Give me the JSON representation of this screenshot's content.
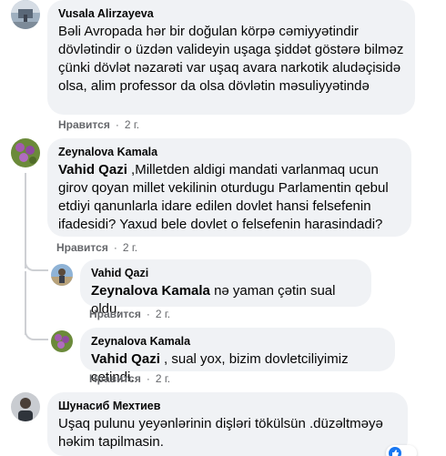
{
  "comments": [
    {
      "author": "Vusala Alirzayeva",
      "text": "Bəli Avropada hər bir doğulan körpə cəmiyyətindir dövlətindir o üzdən valideyin uşaga şiddət göstərə bilməz çünki dövlət nəzarəti var uşaq avara narkotik aludəçisidə olsa, alim professor da olsa dövlətin məsuliyyətində",
      "like_label": "Нравится",
      "time": "2 г."
    },
    {
      "author": "Zeynalova Kamala",
      "mention": "Vahid Qazi",
      "text": " ,Milletden aldigi mandati varlanmaq ucun girov qoyan millet vekilinin oturdugu Parlamentin qebul etdiyi qanunlarla idare edilen dovlet hansi felsefenin ifadesidi? Yaxud bele dovlet o felsefenin harasindadi?",
      "like_label": "Нравится",
      "time": "2 г."
    },
    {
      "author": "Vahid Qazi",
      "mention": "Zeynalova Kamala",
      "text": " nə yaman çətin sual oldu.",
      "like_label": "Нравится",
      "time": "2 г."
    },
    {
      "author": "Zeynalova Kamala",
      "mention": "Vahid Qazi",
      "text": " , sual yox, bizim dovletciliyimiz cetindi.",
      "like_label": "Нравится",
      "time": "2 г."
    },
    {
      "author": "Шунасиб Мехтиев",
      "text": "Uşaq pulunu yeyənlərinin dişləri tökülsün .düzəltməyə həkim tapilmasin."
    }
  ],
  "separator": "·",
  "colors": {
    "bubble": "#f0f2f5",
    "text": "#050505",
    "meta": "#65676b",
    "thread_line": "#ced0d4"
  }
}
